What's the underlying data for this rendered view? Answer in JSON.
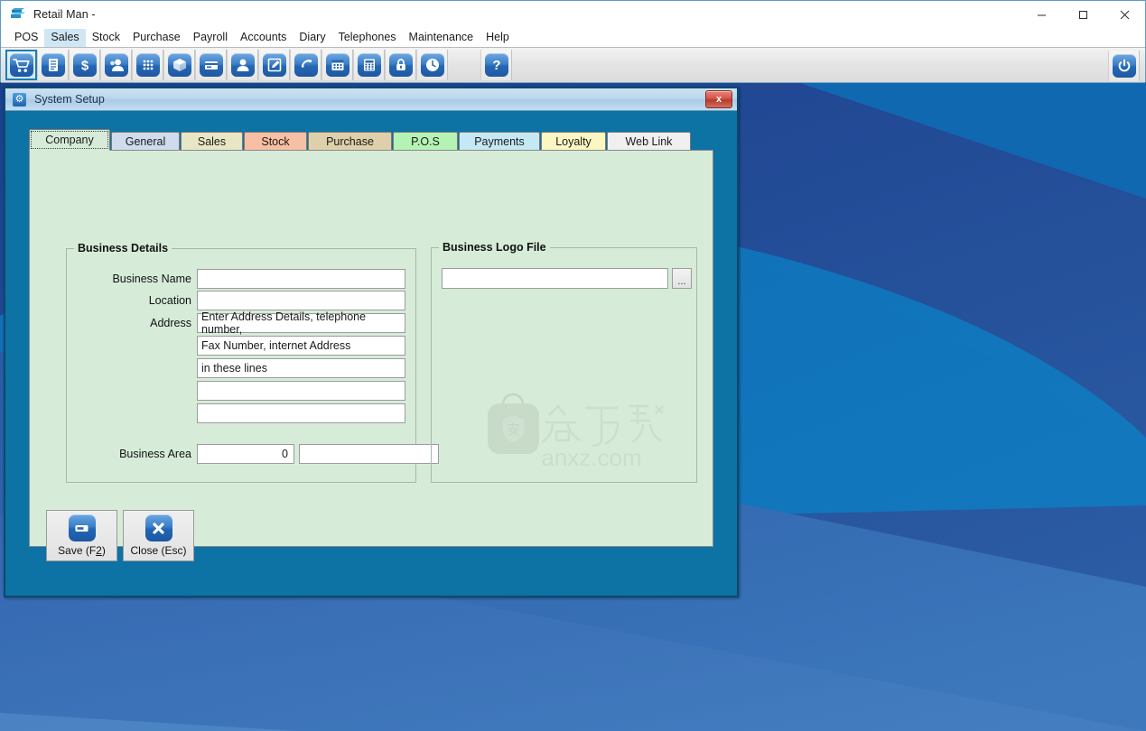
{
  "window": {
    "app_icon": "retail-man-logo-icon",
    "title": "Retail Man -",
    "minimize_label": "─",
    "maximize_label": "☐",
    "close_label": "✕"
  },
  "menubar": {
    "items": [
      {
        "label": "POS",
        "active": false
      },
      {
        "label": "Sales",
        "active": true
      },
      {
        "label": "Stock",
        "active": false
      },
      {
        "label": "Purchase",
        "active": false
      },
      {
        "label": "Payroll",
        "active": false
      },
      {
        "label": "Accounts",
        "active": false
      },
      {
        "label": "Diary",
        "active": false
      },
      {
        "label": "Telephones",
        "active": false
      },
      {
        "label": "Maintenance",
        "active": false
      },
      {
        "label": "Help",
        "active": false
      }
    ]
  },
  "toolbar": {
    "buttons": [
      {
        "icon": "shopping-cart-icon",
        "selected": true
      },
      {
        "icon": "invoice-document-icon",
        "selected": false
      },
      {
        "icon": "dollar-sign-icon",
        "selected": false
      },
      {
        "icon": "customer-person-icon",
        "selected": false
      },
      {
        "icon": "grid-dots-icon",
        "selected": false
      },
      {
        "icon": "package-box-icon",
        "selected": false
      },
      {
        "icon": "credit-card-icon",
        "selected": false
      },
      {
        "icon": "user-profile-icon",
        "selected": false
      },
      {
        "icon": "edit-pencil-icon",
        "selected": false
      },
      {
        "icon": "telephone-icon",
        "selected": false
      },
      {
        "icon": "calendar-icon",
        "selected": false
      },
      {
        "icon": "calculator-icon",
        "selected": false
      },
      {
        "icon": "lock-icon",
        "selected": false
      },
      {
        "icon": "clock-icon",
        "selected": false
      }
    ],
    "help_button": {
      "icon": "question-mark-icon",
      "label": "?"
    },
    "power_button": {
      "icon": "power-icon"
    }
  },
  "dialog": {
    "icon": "gear-icon",
    "title": "System Setup",
    "close_label": "x",
    "tabs": [
      {
        "label": "Company",
        "color": "#d6ecd8",
        "selected": true
      },
      {
        "label": "General",
        "color": "#cfdced",
        "selected": false
      },
      {
        "label": "Sales",
        "color": "#e8e6c4",
        "selected": false
      },
      {
        "label": "Stock",
        "color": "#f7bfa3",
        "selected": false
      },
      {
        "label": "Purchase",
        "color": "#ddd0ab",
        "selected": false
      },
      {
        "label": "P.O.S",
        "color": "#b5f3b5",
        "selected": false
      },
      {
        "label": "Payments",
        "color": "#c5e9f4",
        "selected": false
      },
      {
        "label": "Loyalty",
        "color": "#fbf6c2",
        "selected": false
      },
      {
        "label": "Web Link",
        "color": "#f0f0f0",
        "selected": false
      }
    ],
    "business_details": {
      "legend": "Business Details",
      "fields": [
        {
          "label": "Business Name",
          "value": ""
        },
        {
          "label": "Location",
          "value": ""
        },
        {
          "label": "Address",
          "value": "Enter Address Details, telephone number,"
        },
        {
          "label": "",
          "value": "Fax Number, internet Address"
        },
        {
          "label": "",
          "value": "in these lines"
        },
        {
          "label": "",
          "value": ""
        },
        {
          "label": "",
          "value": ""
        }
      ],
      "business_area": {
        "label": "Business Area",
        "value": "0",
        "value2": ""
      }
    },
    "business_logo": {
      "legend": "Business Logo File",
      "path_value": "",
      "browse_label": "...",
      "watermark_text": "anxz.com",
      "watermark_mark": "安"
    },
    "buttons": [
      {
        "icon": "save-icon",
        "label_pre": "Save (F",
        "label_key": "2",
        "label_post": ")"
      },
      {
        "icon": "close-x-icon",
        "label_pre": "Close (Esc",
        "label_key": "",
        "label_post": ")"
      }
    ]
  },
  "colors": {
    "dialog_body": "#0d72a4",
    "tab_page": "#d6ecd8",
    "accent_blue": "#2567b4",
    "desktop_dark": "#1b3f8f",
    "desktop_mid": "#1565a8",
    "desktop_light": "#3a71b8"
  }
}
